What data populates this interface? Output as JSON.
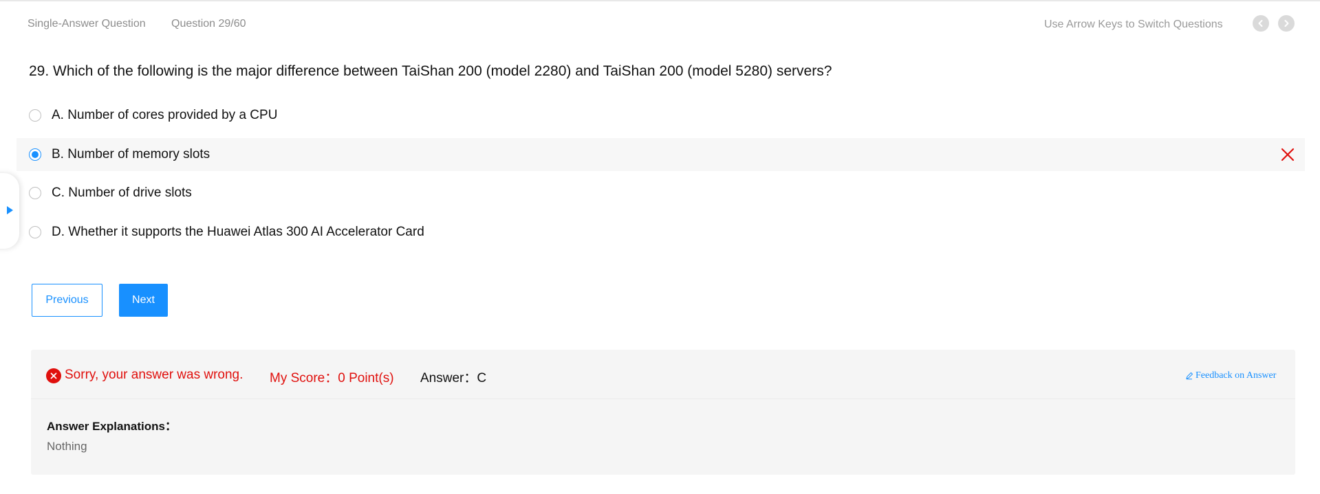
{
  "header": {
    "question_type": "Single-Answer Question",
    "question_progress": "Question 29/60",
    "hint": "Use Arrow Keys to Switch Questions",
    "prev_icon": "chevron-left-icon",
    "next_icon": "chevron-right-icon"
  },
  "question": {
    "text": "29. Which of the following is the major difference between TaiShan 200 (model 2280) and TaiShan 200 (model 5280) servers?",
    "options": [
      {
        "label": "A. Number of cores provided by a CPU",
        "selected": false
      },
      {
        "label": "B. Number of memory slots",
        "selected": true,
        "marked_wrong": true
      },
      {
        "label": "C. Number of drive slots",
        "selected": false
      },
      {
        "label": "D. Whether it supports the Huawei Atlas 300 AI Accelerator Card",
        "selected": false
      }
    ]
  },
  "buttons": {
    "previous": "Previous",
    "next": "Next"
  },
  "result": {
    "status": "Sorry, your answer was wrong.",
    "score": "My Score：0 Point(s)",
    "answer": "Answer：C",
    "feedback": "Feedback on Answer",
    "explanation_title": "Answer Explanations：",
    "explanation_text": "Nothing"
  },
  "colors": {
    "accent": "#1890ff",
    "error": "#e0100d",
    "muted_text": "#8c8c8c",
    "panel_bg": "#f5f5f5"
  }
}
